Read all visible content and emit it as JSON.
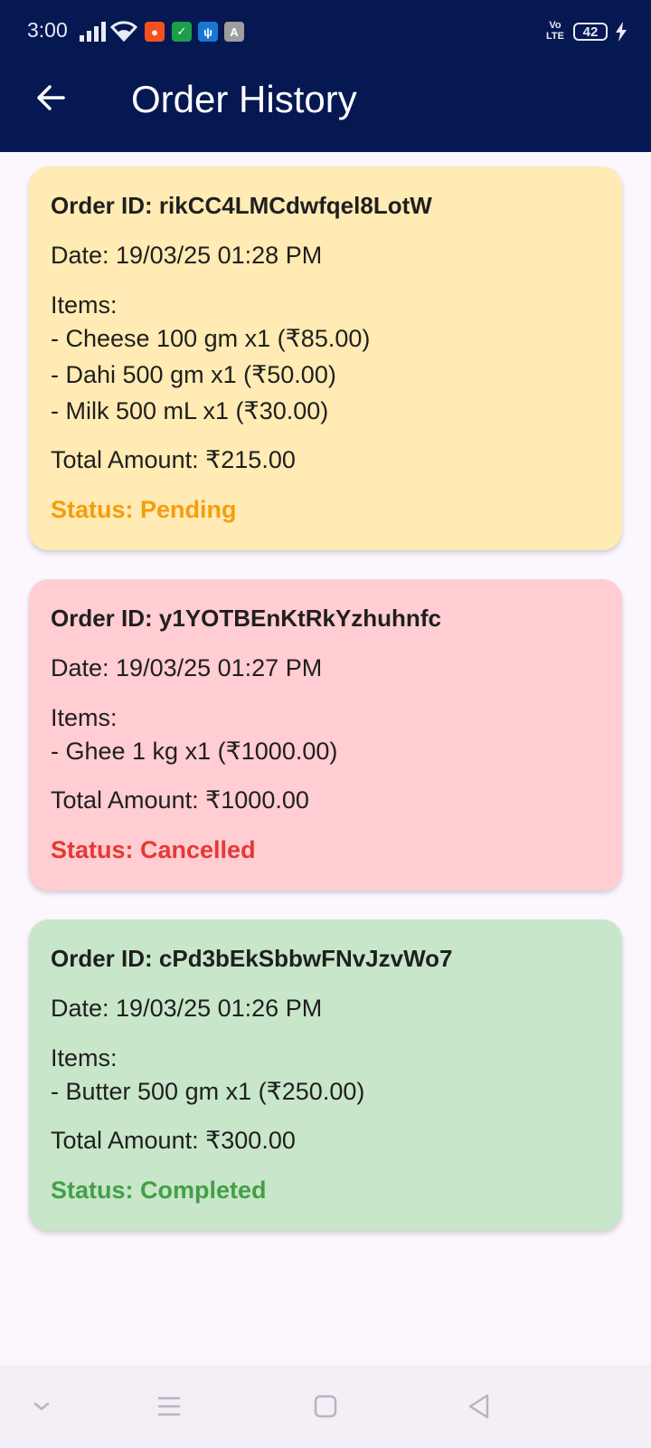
{
  "status_bar": {
    "time": "3:00",
    "volte_line1": "Vo",
    "volte_line2": "LTE",
    "battery": "42",
    "icons": [
      "signal-icon",
      "wifi-icon",
      "app-notification-icon",
      "shield-notification-icon",
      "usb-icon",
      "store-notification-icon",
      "charging-icon"
    ]
  },
  "header": {
    "title": "Order History",
    "back_icon": "arrow-back-icon"
  },
  "orders": [
    {
      "order_id": "Order ID: rikCC4LMCdwfqel8LotW",
      "date": "Date: 19/03/25 01:28 PM",
      "items_label": "Items:",
      "items": [
        "- Cheese 100 gm x1 (₹85.00)",
        "- Dahi 500 gm x1 (₹50.00)",
        "- Milk 500 mL x1 (₹30.00)"
      ],
      "total": "Total Amount: ₹215.00",
      "status": "Status: Pending",
      "status_key": "pending",
      "card_color": "#ffebb3",
      "status_color": "#f59d0e"
    },
    {
      "order_id": "Order ID: y1YOTBEnKtRkYzhuhnfc",
      "date": "Date: 19/03/25 01:27 PM",
      "items_label": "Items:",
      "items": [
        "- Ghee 1 kg x1 (₹1000.00)"
      ],
      "total": "Total Amount: ₹1000.00",
      "status": "Status: Cancelled",
      "status_key": "cancelled",
      "card_color": "#ffcdd2",
      "status_color": "#e53935"
    },
    {
      "order_id": "Order ID: cPd3bEkSbbwFNvJzvWo7",
      "date": "Date: 19/03/25 01:26 PM",
      "items_label": "Items:",
      "items": [
        "- Butter 500 gm x1 (₹250.00)"
      ],
      "total": "Total Amount: ₹300.00",
      "status": "Status: Completed",
      "status_key": "completed",
      "card_color": "#c8e6c9",
      "status_color": "#43a047"
    }
  ],
  "nav_bar": {
    "icons": [
      "chevron-down-icon",
      "menu-icon",
      "home-square-icon",
      "back-triangle-icon"
    ]
  },
  "colors": {
    "app_bar": "#061852",
    "background": "#fcf7ff"
  }
}
